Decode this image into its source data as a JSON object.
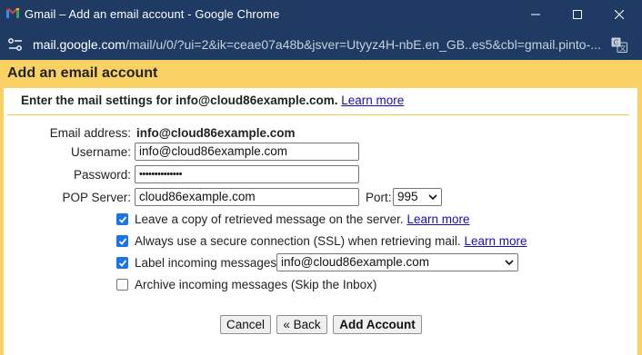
{
  "window": {
    "title": "Gmail – Add an email account - Google Chrome",
    "url_domain": "mail.google.com",
    "url_path": "/mail/u/0/?ui=2&ik=ceae07a48b&jsver=Utyyz4H-nbE.en_GB..es5&cbl=gmail.pinto-...",
    "icons": [
      "gmail-logo-icon",
      "minimize-icon",
      "maximize-icon",
      "close-icon",
      "site-settings-icon",
      "translate-icon"
    ]
  },
  "page": {
    "heading": "Add an email account",
    "intro": "Enter the mail settings for info@cloud86example.com.",
    "intro_link": "Learn more"
  },
  "form": {
    "email_label": "Email address:",
    "email_value": "info@cloud86example.com",
    "username_label": "Username:",
    "username_value": "info@cloud86example.com",
    "password_label": "Password:",
    "password_value": "••••••••••••••",
    "pop_label": "POP Server:",
    "pop_value": "cloud86example.com",
    "port_label": "Port:",
    "port_value": "995"
  },
  "options": [
    {
      "label": "Leave a copy of retrieved message on the server.",
      "checked": true,
      "link": "Learn more"
    },
    {
      "label": "Always use a secure connection (SSL) when retrieving mail.",
      "checked": true,
      "link": "Learn more"
    },
    {
      "label": "Label incoming messages:",
      "checked": true,
      "select_value": "info@cloud86example.com"
    },
    {
      "label": "Archive incoming messages (Skip the Inbox)",
      "checked": false
    }
  ],
  "buttons": {
    "cancel": "Cancel",
    "back": "« Back",
    "add": "Add Account"
  },
  "colors": {
    "chrome_frame": "#1f3b63",
    "header_band": "#fad163",
    "link": "#1a0dab",
    "checkbox": "#1a73e8"
  }
}
